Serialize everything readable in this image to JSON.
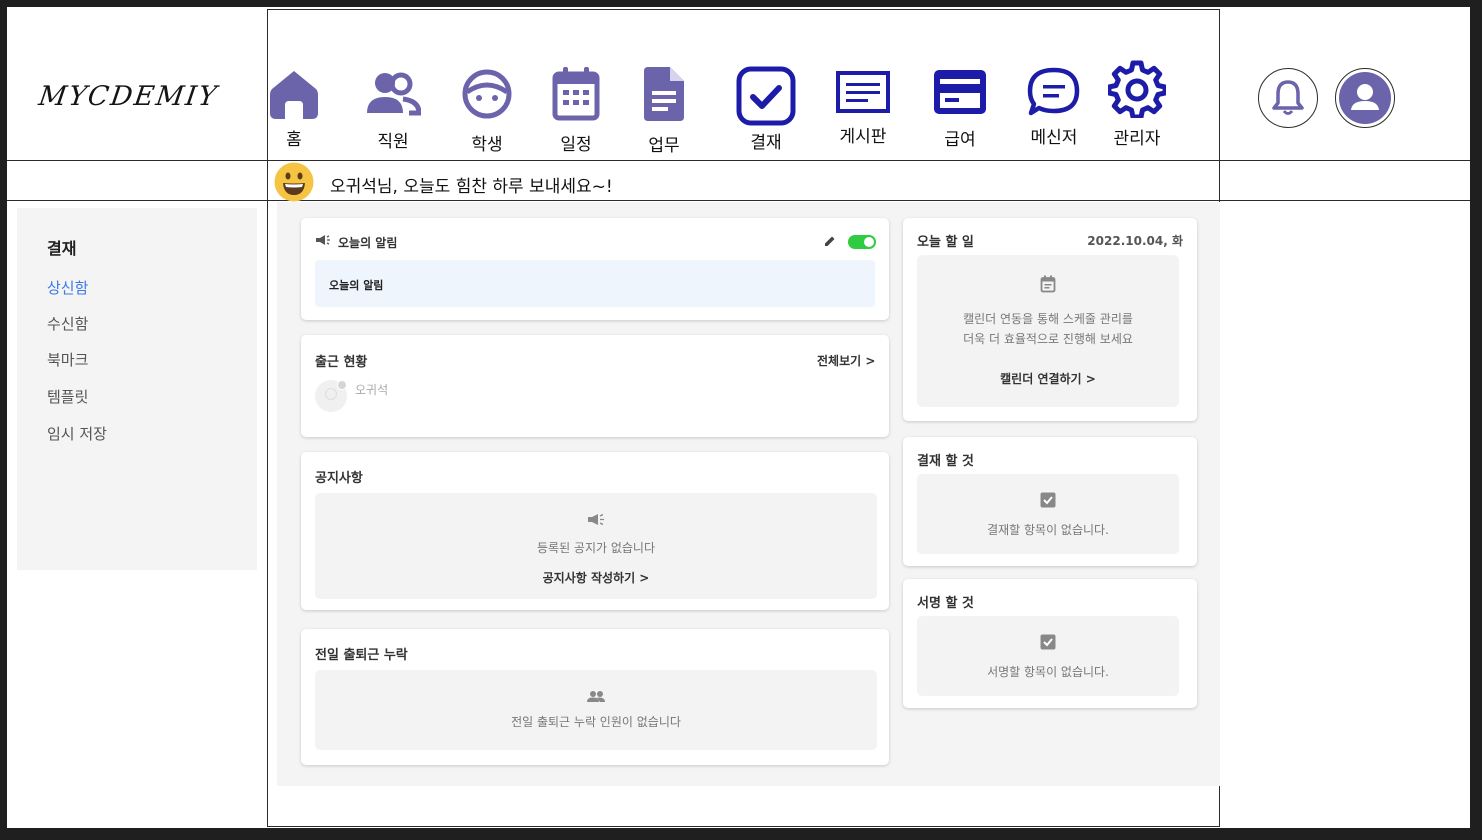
{
  "logo": "MYCDEMIY",
  "nav": [
    {
      "label": "홈",
      "icon": "home-icon"
    },
    {
      "label": "직원",
      "icon": "users-icon"
    },
    {
      "label": "학생",
      "icon": "student-face-icon"
    },
    {
      "label": "일정",
      "icon": "calendar-icon"
    },
    {
      "label": "업무",
      "icon": "document-icon"
    },
    {
      "label": "결재",
      "icon": "approval-check-icon"
    },
    {
      "label": "게시판",
      "icon": "board-icon"
    },
    {
      "label": "급여",
      "icon": "credit-card-icon"
    },
    {
      "label": "메신저",
      "icon": "chat-icon"
    },
    {
      "label": "관리자",
      "icon": "gear-icon"
    }
  ],
  "header_actions": {
    "notification_icon": "bell-icon",
    "profile_icon": "account-icon"
  },
  "greeting": "오귀석님, 오늘도 힘찬 하루 보내세요~!",
  "sidebar": {
    "title": "결재",
    "items": [
      {
        "label": "상신함",
        "active": true
      },
      {
        "label": "수신함",
        "active": false
      },
      {
        "label": "북마크",
        "active": false
      },
      {
        "label": "템플릿",
        "active": false
      },
      {
        "label": "임시 저장",
        "active": false
      }
    ]
  },
  "today_notice": {
    "title": "오늘의 알림",
    "body": "오늘의 알림",
    "toggle_on": true
  },
  "attendance": {
    "title": "출근 현황",
    "view_all": "전체보기 >",
    "person": "오귀석"
  },
  "notices": {
    "title": "공지사항",
    "empty": "등록된 공지가 없습니다",
    "action": "공지사항 작성하기 >"
  },
  "missing": {
    "title": "전일 출퇴근 누락",
    "empty": "전일 출퇴근 누락 인원이 없습니다"
  },
  "todo": {
    "title": "오늘 할 일",
    "date": "2022.10.04, 화",
    "line1": "캘린더 연동을 통해 스케줄 관리를",
    "line2": "더욱 더 효율적으로 진행해 보세요",
    "action": "캘린더 연결하기 >"
  },
  "approve": {
    "title": "결재 할 것",
    "empty": "결재할 항목이 없습니다."
  },
  "sign": {
    "title": "서명 할 것",
    "empty": "서명할 항목이 없습니다."
  },
  "colors": {
    "nav_purple": "#6b64ab",
    "nav_navy": "#1c1ca8",
    "active_link": "#3b78e7",
    "toggle_green": "#2ecc40"
  }
}
